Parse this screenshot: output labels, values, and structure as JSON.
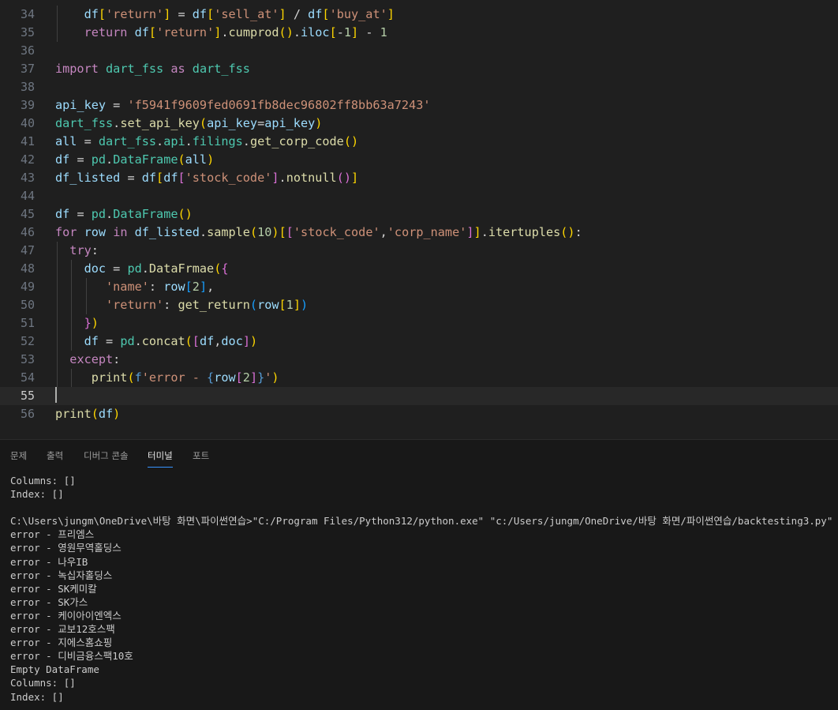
{
  "editor": {
    "active_line": "55",
    "lines": [
      {
        "n": "34",
        "tokens": [
          [
            "    ",
            "t-op"
          ],
          [
            "df",
            "t-var"
          ],
          [
            "[",
            "b1"
          ],
          [
            "'return'",
            "t-str"
          ],
          [
            "]",
            "b1"
          ],
          [
            " = ",
            "t-op"
          ],
          [
            "df",
            "t-var"
          ],
          [
            "[",
            "b1"
          ],
          [
            "'sell_at'",
            "t-str"
          ],
          [
            "]",
            "b1"
          ],
          [
            " / ",
            "t-op"
          ],
          [
            "df",
            "t-var"
          ],
          [
            "[",
            "b1"
          ],
          [
            "'buy_at'",
            "t-str"
          ],
          [
            "]",
            "b1"
          ]
        ]
      },
      {
        "n": "35",
        "tokens": [
          [
            "    ",
            "t-op"
          ],
          [
            "return",
            "t-kw"
          ],
          [
            " ",
            "t-op"
          ],
          [
            "df",
            "t-var"
          ],
          [
            "[",
            "b1"
          ],
          [
            "'return'",
            "t-str"
          ],
          [
            "]",
            "b1"
          ],
          [
            ".",
            "t-op"
          ],
          [
            "cumprod",
            "t-fn"
          ],
          [
            "()",
            "b1"
          ],
          [
            ".",
            "t-op"
          ],
          [
            "iloc",
            "t-var"
          ],
          [
            "[",
            "b1"
          ],
          [
            "-",
            "t-op"
          ],
          [
            "1",
            "t-num"
          ],
          [
            "]",
            "b1"
          ],
          [
            " - ",
            "t-op"
          ],
          [
            "1",
            "t-num"
          ]
        ]
      },
      {
        "n": "36",
        "tokens": []
      },
      {
        "n": "37",
        "tokens": [
          [
            "import",
            "t-kw"
          ],
          [
            " ",
            "t-op"
          ],
          [
            "dart_fss",
            "t-cls"
          ],
          [
            " ",
            "t-op"
          ],
          [
            "as",
            "t-kw"
          ],
          [
            " ",
            "t-op"
          ],
          [
            "dart_fss",
            "t-cls"
          ]
        ]
      },
      {
        "n": "38",
        "tokens": []
      },
      {
        "n": "39",
        "tokens": [
          [
            "api_key",
            "t-var"
          ],
          [
            " = ",
            "t-op"
          ],
          [
            "'f5941f9609fed0691fb8dec96802ff8bb63a7243'",
            "t-str"
          ]
        ]
      },
      {
        "n": "40",
        "tokens": [
          [
            "dart_fss",
            "t-cls"
          ],
          [
            ".",
            "t-op"
          ],
          [
            "set_api_key",
            "t-fn"
          ],
          [
            "(",
            "b1"
          ],
          [
            "api_key",
            "t-var"
          ],
          [
            "=",
            "t-op"
          ],
          [
            "api_key",
            "t-var"
          ],
          [
            ")",
            "b1"
          ]
        ]
      },
      {
        "n": "41",
        "tokens": [
          [
            "all",
            "t-var"
          ],
          [
            " = ",
            "t-op"
          ],
          [
            "dart_fss",
            "t-cls"
          ],
          [
            ".",
            "t-op"
          ],
          [
            "api",
            "t-cls"
          ],
          [
            ".",
            "t-op"
          ],
          [
            "filings",
            "t-cls"
          ],
          [
            ".",
            "t-op"
          ],
          [
            "get_corp_code",
            "t-fn"
          ],
          [
            "()",
            "b1"
          ]
        ]
      },
      {
        "n": "42",
        "tokens": [
          [
            "df",
            "t-var"
          ],
          [
            " = ",
            "t-op"
          ],
          [
            "pd",
            "t-cls"
          ],
          [
            ".",
            "t-op"
          ],
          [
            "DataFrame",
            "t-cls"
          ],
          [
            "(",
            "b1"
          ],
          [
            "all",
            "t-var"
          ],
          [
            ")",
            "b1"
          ]
        ]
      },
      {
        "n": "43",
        "tokens": [
          [
            "df_listed",
            "t-var"
          ],
          [
            " = ",
            "t-op"
          ],
          [
            "df",
            "t-var"
          ],
          [
            "[",
            "b1"
          ],
          [
            "df",
            "t-var"
          ],
          [
            "[",
            "b2"
          ],
          [
            "'stock_code'",
            "t-str"
          ],
          [
            "]",
            "b2"
          ],
          [
            ".",
            "t-op"
          ],
          [
            "notnull",
            "t-fn"
          ],
          [
            "()",
            "b2"
          ],
          [
            "]",
            "b1"
          ]
        ]
      },
      {
        "n": "44",
        "tokens": []
      },
      {
        "n": "45",
        "tokens": [
          [
            "df",
            "t-var"
          ],
          [
            " = ",
            "t-op"
          ],
          [
            "pd",
            "t-cls"
          ],
          [
            ".",
            "t-op"
          ],
          [
            "DataFrame",
            "t-cls"
          ],
          [
            "()",
            "b1"
          ]
        ]
      },
      {
        "n": "46",
        "tokens": [
          [
            "for",
            "t-kw"
          ],
          [
            " ",
            "t-op"
          ],
          [
            "row",
            "t-var"
          ],
          [
            " ",
            "t-op"
          ],
          [
            "in",
            "t-kw"
          ],
          [
            " ",
            "t-op"
          ],
          [
            "df_listed",
            "t-var"
          ],
          [
            ".",
            "t-op"
          ],
          [
            "sample",
            "t-fn"
          ],
          [
            "(",
            "b1"
          ],
          [
            "10",
            "t-num"
          ],
          [
            ")",
            "b1"
          ],
          [
            "[",
            "b1"
          ],
          [
            "[",
            "b2"
          ],
          [
            "'stock_code'",
            "t-str"
          ],
          [
            ",",
            "t-op"
          ],
          [
            "'corp_name'",
            "t-str"
          ],
          [
            "]",
            "b2"
          ],
          [
            "]",
            "b1"
          ],
          [
            ".",
            "t-op"
          ],
          [
            "itertuples",
            "t-fn"
          ],
          [
            "()",
            "b1"
          ],
          [
            ":",
            "t-op"
          ]
        ]
      },
      {
        "n": "47",
        "tokens": [
          [
            "  ",
            "t-op"
          ],
          [
            "try",
            "t-kw"
          ],
          [
            ":",
            "t-op"
          ]
        ]
      },
      {
        "n": "48",
        "tokens": [
          [
            "    ",
            "t-op"
          ],
          [
            "doc",
            "t-var"
          ],
          [
            " = ",
            "t-op"
          ],
          [
            "pd",
            "t-cls"
          ],
          [
            ".",
            "t-op"
          ],
          [
            "DataFrmae",
            "t-fn"
          ],
          [
            "(",
            "b1"
          ],
          [
            "{",
            "b2"
          ]
        ]
      },
      {
        "n": "49",
        "tokens": [
          [
            "       ",
            "t-op"
          ],
          [
            "'name'",
            "t-str"
          ],
          [
            ": ",
            "t-op"
          ],
          [
            "row",
            "t-var"
          ],
          [
            "[",
            "b3"
          ],
          [
            "2",
            "t-num"
          ],
          [
            "]",
            "b3"
          ],
          [
            ",",
            "t-op"
          ]
        ]
      },
      {
        "n": "50",
        "tokens": [
          [
            "       ",
            "t-op"
          ],
          [
            "'return'",
            "t-str"
          ],
          [
            ": ",
            "t-op"
          ],
          [
            "get_return",
            "t-fn"
          ],
          [
            "(",
            "b3"
          ],
          [
            "row",
            "t-var"
          ],
          [
            "[",
            "b1"
          ],
          [
            "1",
            "t-num"
          ],
          [
            "]",
            "b1"
          ],
          [
            ")",
            "b3"
          ]
        ]
      },
      {
        "n": "51",
        "tokens": [
          [
            "    ",
            "t-op"
          ],
          [
            "}",
            "b2"
          ],
          [
            ")",
            "b1"
          ]
        ]
      },
      {
        "n": "52",
        "tokens": [
          [
            "    ",
            "t-op"
          ],
          [
            "df",
            "t-var"
          ],
          [
            " = ",
            "t-op"
          ],
          [
            "pd",
            "t-cls"
          ],
          [
            ".",
            "t-op"
          ],
          [
            "concat",
            "t-fn"
          ],
          [
            "(",
            "b1"
          ],
          [
            "[",
            "b2"
          ],
          [
            "df",
            "t-var"
          ],
          [
            ",",
            "t-op"
          ],
          [
            "doc",
            "t-var"
          ],
          [
            "]",
            "b2"
          ],
          [
            ")",
            "b1"
          ]
        ]
      },
      {
        "n": "53",
        "tokens": [
          [
            "  ",
            "t-op"
          ],
          [
            "except",
            "t-kw"
          ],
          [
            ":",
            "t-op"
          ]
        ]
      },
      {
        "n": "54",
        "tokens": [
          [
            "     ",
            "t-op"
          ],
          [
            "print",
            "t-fn"
          ],
          [
            "(",
            "b1"
          ],
          [
            "f",
            "t-kwb"
          ],
          [
            "'error - ",
            "t-str"
          ],
          [
            "{",
            "t-kwb"
          ],
          [
            "row",
            "t-var"
          ],
          [
            "[",
            "b2"
          ],
          [
            "2",
            "t-num"
          ],
          [
            "]",
            "b2"
          ],
          [
            "}",
            "t-kwb"
          ],
          [
            "'",
            "t-str"
          ],
          [
            ")",
            "b1"
          ]
        ]
      },
      {
        "n": "55",
        "tokens": []
      },
      {
        "n": "56",
        "tokens": [
          [
            "print",
            "t-fn"
          ],
          [
            "(",
            "b1"
          ],
          [
            "df",
            "t-var"
          ],
          [
            ")",
            "b1"
          ]
        ]
      }
    ]
  },
  "panel": {
    "tabs": [
      {
        "label": "문제",
        "active": false
      },
      {
        "label": "출력",
        "active": false
      },
      {
        "label": "디버그 콘솔",
        "active": false
      },
      {
        "label": "터미널",
        "active": true
      },
      {
        "label": "포트",
        "active": false
      }
    ],
    "terminal_lines": [
      "Columns: []",
      "Index: []",
      "",
      "C:\\Users\\jungm\\OneDrive\\바탕 화면\\파이썬연습>\"C:/Program Files/Python312/python.exe\" \"c:/Users/jungm/OneDrive/바탕 화면/파이썬연습/backtesting3.py\"",
      "error - 프리엠스",
      "error - 영원무역홀딩스",
      "error - 나우IB",
      "error - 녹십자홀딩스",
      "error - SK케미칼",
      "error - SK가스",
      "error - 케이아이엔엑스",
      "error - 교보12호스팩",
      "error - 지에스홈쇼핑",
      "error - 디비금융스팩10호",
      "Empty DataFrame",
      "Columns: []",
      "Index: []"
    ]
  }
}
